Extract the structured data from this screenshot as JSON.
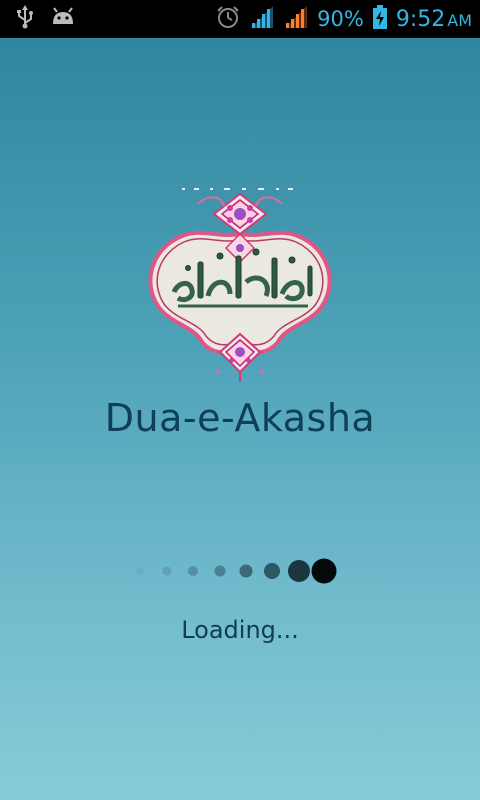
{
  "status_bar": {
    "battery_percent": "90%",
    "time": "9:52",
    "ampm": "AM",
    "icons": [
      "usb-icon",
      "android-icon",
      "alarm-icon",
      "signal-icon",
      "signal-icon",
      "battery-charging-icon"
    ]
  },
  "splash": {
    "app_title": "Dua-e-Akasha",
    "loading_text": "Loading...",
    "logo_icon": "dua-e-akasha-calligraphy-logo",
    "progress_step": 8,
    "progress_total": 8
  },
  "colors": {
    "background_top": "#2f869f",
    "background_bottom": "#86cbd8",
    "title_text": "#0e3f56",
    "status_accent": "#33b5e5"
  }
}
